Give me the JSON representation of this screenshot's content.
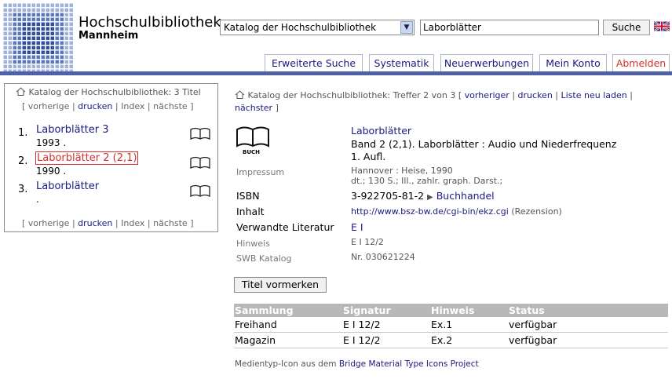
{
  "header": {
    "brand_title": "Hochschulbibliothek",
    "brand_subtitle": "Mannheim",
    "catalog_select_value": "Katalog der Hochschulbibliothek",
    "search_value": "Laborblätter",
    "search_button": "Suche",
    "flag_icon": "uk-flag-icon",
    "colors": {
      "tab_line": "#5060a8",
      "logo": "#3050a0",
      "logout": "#d03030"
    }
  },
  "tabs": [
    {
      "label": "Erweiterte Suche"
    },
    {
      "label": "Systematik"
    },
    {
      "label": "Neuerwerbungen"
    },
    {
      "label": "Mein Konto"
    },
    {
      "label": "Abmelden"
    }
  ],
  "left": {
    "heading": "Katalog der Hochschulbibliothek: 3 Titel",
    "nav_open": "[",
    "nav_prev": "vorherige",
    "nav_sep": "|",
    "nav_print": "drucken",
    "nav_index": "Index",
    "nav_next": "nächste",
    "nav_close": "]",
    "results": [
      {
        "num": "1.",
        "title": "Laborblätter 3",
        "year": "1993 ."
      },
      {
        "num": "2.",
        "title": "Laborblätter 2 (2,1)",
        "year": "1990 ."
      },
      {
        "num": "3.",
        "title": "Laborblätter",
        "year": "."
      }
    ]
  },
  "detail": {
    "breadcrumb": "Katalog der Hochschulbibliothek: Treffer 2 von 3",
    "bracket_open": "[",
    "bracket_close": "]",
    "sep": "|",
    "link_prev": "vorheriger",
    "link_print": "drucken",
    "link_reload": "Liste neu laden",
    "link_next": "nächster",
    "media_icon_label": "BUCH",
    "title_link": "Laborblätter",
    "title_line2": "Band 2 (2,1). Laborblätter : Audio und Niederfrequenz",
    "title_line3": "1. Aufl.",
    "impressum_label": "Impressum",
    "impressum_line1": "Hannover : Heise, 1990",
    "impressum_line2": "dt.; 130 S.; Ill., zahlr. graph. Darst.;",
    "isbn_label": "ISBN",
    "isbn_value": "3-922705-81-2",
    "isbn_link": "Buchhandel",
    "inhalt_label": "Inhalt",
    "inhalt_link": "http://www.bsz-bw.de/cgi-bin/ekz.cgi",
    "inhalt_note": "(Rezension)",
    "verwandte_label": "Verwandte Literatur",
    "verwandte_link": "E I",
    "hinweis_label": "Hinweis",
    "hinweis_value": "E I 12/2",
    "swb_label": "SWB Katalog",
    "swb_value": "Nr. 030621224",
    "reserve_button": "Titel vormerken"
  },
  "holdings": {
    "headers": [
      "Sammlung",
      "Signatur",
      "Hinweis",
      "Status"
    ],
    "rows": [
      [
        "Freihand",
        "E I 12/2",
        "Ex.1",
        "verfügbar"
      ],
      [
        "Magazin",
        "E I 12/2",
        "Ex.2",
        "verfügbar"
      ]
    ]
  },
  "footer": {
    "text": "Medientyp-Icon aus dem",
    "link": "Bridge Material Type Icons Project"
  }
}
